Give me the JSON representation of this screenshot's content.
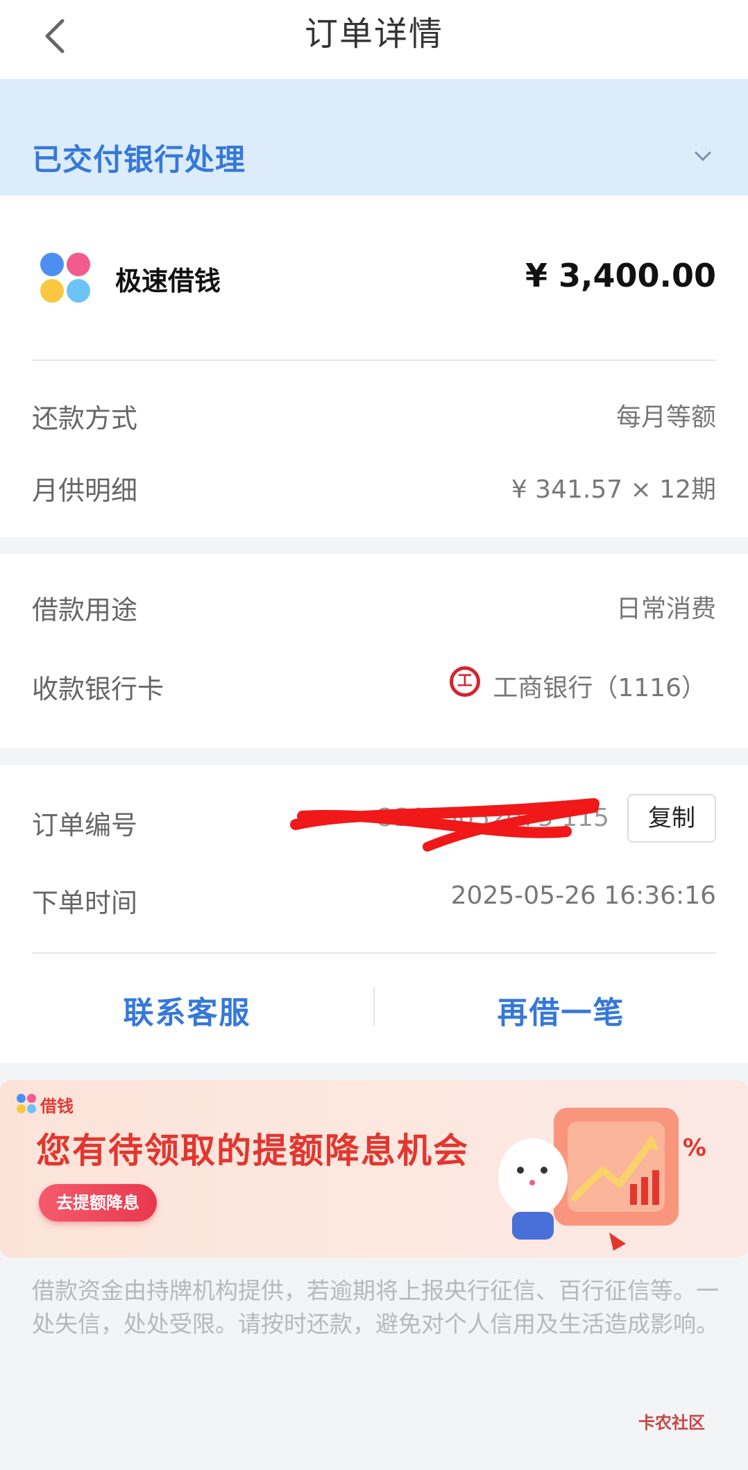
{
  "nav": {
    "title": "订单详情"
  },
  "status": {
    "text": "已交付银行处理"
  },
  "product": {
    "name": "极速借钱",
    "amount": "¥ 3,400.00"
  },
  "details": {
    "repay_method_label": "还款方式",
    "repay_method_value": "每月等额",
    "monthly_label": "月供明细",
    "monthly_value": "¥ 341.57 × 12期"
  },
  "loan": {
    "purpose_label": "借款用途",
    "purpose_value": "日常消费",
    "bank_label": "收款银行卡",
    "bank_icon_text": "工",
    "bank_value": "工商银行（1116）"
  },
  "order": {
    "number_label": "订单编号",
    "number_value": "O2025052075          115",
    "copy_label": "复制",
    "time_label": "下单时间",
    "time_value": "2025-05-26 16:36:16"
  },
  "actions": {
    "contact": "联系客服",
    "borrow_again": "再借一笔"
  },
  "banner": {
    "brand": "借钱",
    "title": "您有待领取的提额降息机会",
    "button": "去提额降息",
    "percent_sign": "%"
  },
  "disclaimer": "借款资金由持牌机构提供，若逾期将上报央行征信、百行征信等。一处失信，处处受限。请按时还款，避免对个人信用及生活造成影响。",
  "watermark": "卡农社区",
  "colors": {
    "accent": "#3578d8",
    "status_bg": "#dcecfb",
    "banner_red": "#e2362f"
  }
}
